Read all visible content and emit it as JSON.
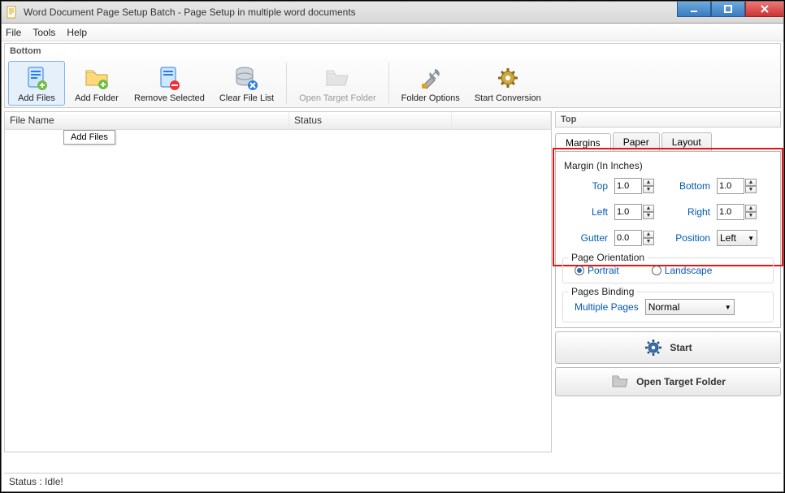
{
  "window": {
    "title": "Word Document Page Setup Batch - Page Setup in multiple word documents"
  },
  "menu": {
    "file": "File",
    "tools": "Tools",
    "help": "Help"
  },
  "toolbar": {
    "section_label": "Bottom",
    "add_files": "Add Files",
    "add_folder": "Add Folder",
    "remove_selected": "Remove Selected",
    "clear_file_list": "Clear File List",
    "open_target_folder": "Open Target Folder",
    "folder_options": "Folder Options",
    "start_conversion": "Start Conversion"
  },
  "columns": {
    "file_name": "File Name",
    "status": "Status"
  },
  "tooltip": "Add Files",
  "right": {
    "top_label": "Top",
    "tabs": {
      "margins": "Margins",
      "paper": "Paper",
      "layout": "Layout"
    },
    "active_tab": "margins",
    "margin_title": "Margin (In Inches)",
    "labels": {
      "top": "Top",
      "bottom": "Bottom",
      "left": "Left",
      "right": "Right",
      "gutter": "Gutter",
      "position": "Position"
    },
    "values": {
      "top": "1.0",
      "bottom": "1.0",
      "left": "1.0",
      "right": "1.0",
      "gutter": "0.0",
      "position": "Left"
    },
    "orientation": {
      "title": "Page Orientation",
      "portrait": "Portrait",
      "landscape": "Landscape",
      "selected": "portrait"
    },
    "binding": {
      "title": "Pages Binding",
      "label": "Multiple Pages",
      "value": "Normal"
    },
    "start": "Start",
    "open_target": "Open Target Folder"
  },
  "status": "Status  :  Idle!"
}
